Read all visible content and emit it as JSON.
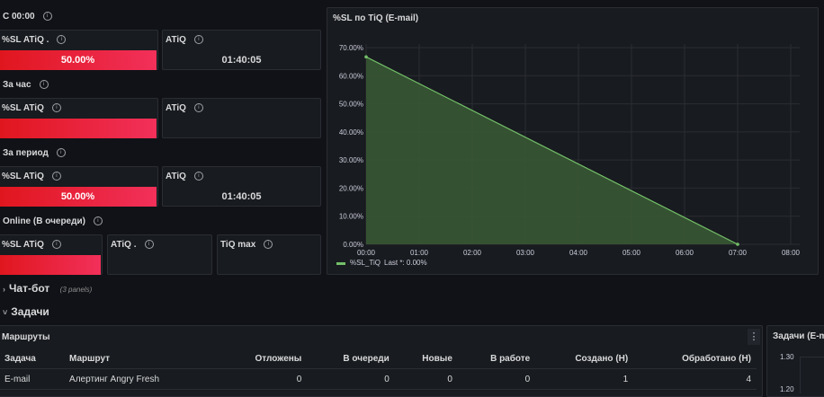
{
  "sections": {
    "since_midnight": "С 00:00",
    "per_hour": "За час",
    "per_period": "За период",
    "online": "Online (В очереди)"
  },
  "panels": {
    "sl1": {
      "title": "%SL ATiQ .",
      "value": "50.00%",
      "fill": 1.0
    },
    "atiq1": {
      "title": "ATiQ",
      "value": "01:40:05"
    },
    "sl2": {
      "title": "%SL ATiQ",
      "fill": 1.0
    },
    "atiq2": {
      "title": "ATiQ"
    },
    "sl3": {
      "title": "%SL ATiQ",
      "value": "50.00%",
      "fill": 1.0
    },
    "atiq3": {
      "title": "ATiQ",
      "value": "01:40:05"
    },
    "sl4": {
      "title": "%SL ATiQ",
      "fill": 1.0
    },
    "atiq4": {
      "title": "ATiQ ."
    },
    "tiqmax": {
      "title": "TiQ max"
    }
  },
  "chart": {
    "title": "%SL по TiQ (E-mail)",
    "legend_series": "%SL_TiQ",
    "legend_last": "Last *: 0.00%",
    "colors": {
      "line": "#73bf69",
      "fill": "#3a5a35",
      "grid": "#2a2d33",
      "text": "#ccccdc"
    }
  },
  "chart_data": {
    "type": "area",
    "x": [
      "00:00",
      "07:00"
    ],
    "values": [
      66.7,
      0
    ],
    "x_ticks": [
      "00:00",
      "01:00",
      "02:00",
      "03:00",
      "04:00",
      "05:00",
      "06:00",
      "07:00",
      "08:00"
    ],
    "y_ticks": [
      "0.00%",
      "10.00%",
      "20.00%",
      "30.00%",
      "40.00%",
      "50.00%",
      "60.00%",
      "70.00%"
    ],
    "ylim": [
      0,
      70
    ],
    "series": [
      {
        "name": "%SL_TiQ",
        "values": [
          66.7,
          0
        ]
      }
    ],
    "legend": "bottom-left",
    "grid": true
  },
  "rows": {
    "chatbot": {
      "label": "Чат-бот",
      "sub": "(3 panels)"
    },
    "tasks": {
      "label": "Задачи"
    }
  },
  "routes": {
    "title": "Маршруты",
    "menu_icon": "⋮",
    "columns": [
      "Задача",
      "Маршрут",
      "Отложены",
      "В очереди",
      "Новые",
      "В работе",
      "Создано (Н)",
      "Обработано (Н)"
    ],
    "rows": [
      [
        "E-mail",
        "Алертинг Angry Fresh",
        "0",
        "0",
        "0",
        "0",
        "1",
        "4"
      ]
    ]
  },
  "tasks_email": {
    "title": "Задачи (E-m",
    "y_ticks": [
      "1.30",
      "1.20"
    ]
  }
}
